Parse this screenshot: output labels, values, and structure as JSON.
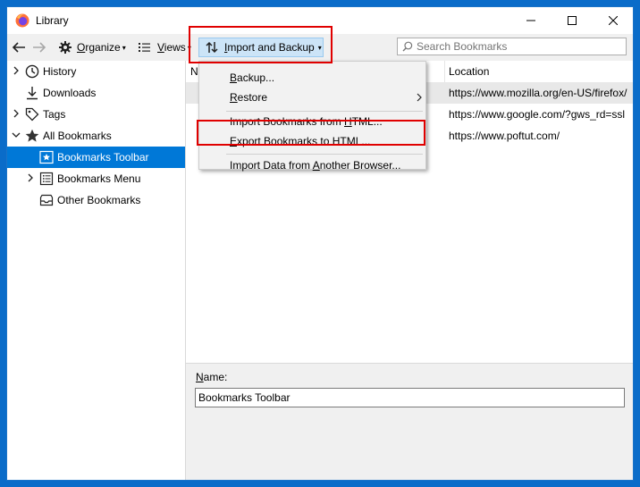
{
  "window": {
    "title": "Library",
    "controls": {
      "minimize": "minimize-icon",
      "maximize": "maximize-icon",
      "close": "close-icon"
    }
  },
  "toolbar": {
    "organize": {
      "pre": "",
      "ul": "O",
      "post": "rganize"
    },
    "views": {
      "pre": "",
      "ul": "V",
      "post": "iews"
    },
    "import_backup": {
      "pre": "",
      "ul": "I",
      "post": "mport and Backup"
    },
    "search_placeholder": "Search Bookmarks"
  },
  "sidebar": {
    "items": [
      {
        "label": "History",
        "icon": "clock-icon",
        "twisty": "collapsed"
      },
      {
        "label": "Downloads",
        "icon": "download-icon",
        "twisty": "none"
      },
      {
        "label": "Tags",
        "icon": "tag-icon",
        "twisty": "collapsed"
      },
      {
        "label": "All Bookmarks",
        "icon": "star-icon",
        "twisty": "expanded"
      },
      {
        "label": "Bookmarks Toolbar",
        "icon": "bookmarks-toolbar-icon",
        "twisty": "none",
        "selected": true
      },
      {
        "label": "Bookmarks Menu",
        "icon": "bookmarks-menu-icon",
        "twisty": "collapsed"
      },
      {
        "label": "Other Bookmarks",
        "icon": "folder-icon",
        "twisty": "none"
      }
    ]
  },
  "list": {
    "columns": {
      "name": "N",
      "location": "Location"
    },
    "rows": [
      {
        "location": "https://www.mozilla.org/en-US/firefox/"
      },
      {
        "location": "https://www.google.com/?gws_rd=ssl"
      },
      {
        "location": "https://www.poftut.com/"
      }
    ]
  },
  "menu": {
    "items": [
      {
        "pre": "",
        "ul": "B",
        "post": "ackup..."
      },
      {
        "pre": "",
        "ul": "R",
        "post": "estore",
        "submenu": true
      },
      {
        "pre": "Import Bookmarks from ",
        "ul": "H",
        "post": "TML..."
      },
      {
        "pre": "",
        "ul": "E",
        "post": "xport Bookmarks to HTML..."
      },
      {
        "pre": "Import Data from ",
        "ul": "A",
        "post": "nother Browser..."
      }
    ]
  },
  "details": {
    "name_label": {
      "pre": "",
      "ul": "N",
      "post": "ame:"
    },
    "name_value": "Bookmarks Toolbar"
  },
  "colors": {
    "selection": "#0078d7",
    "highlight": "#e00000",
    "accent_button": "#cce4f7"
  }
}
